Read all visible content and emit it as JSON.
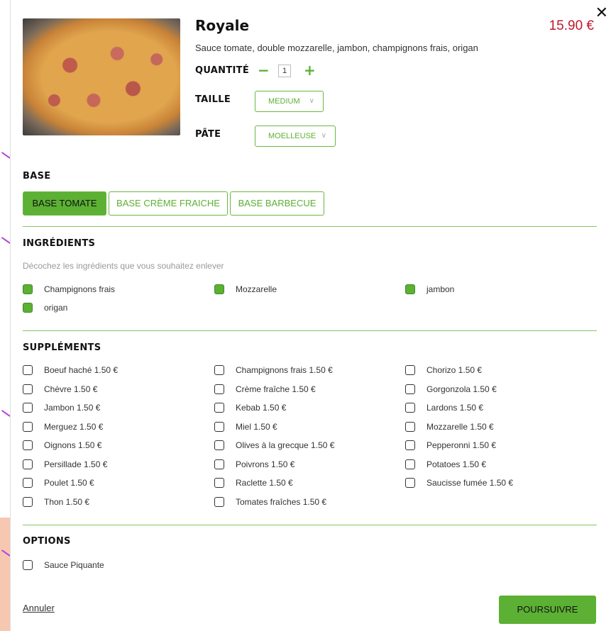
{
  "product": {
    "title": "Royale",
    "price": "15.90 €",
    "description": "Sauce tomate, double mozzarelle, jambon, champignons frais, origan",
    "close_icon": "✕"
  },
  "quantity": {
    "label": "QUANTITÉ",
    "minus": "−",
    "value": "1",
    "plus": "+"
  },
  "size": {
    "label": "TAILLE",
    "value": "MEDIUM",
    "chevron": "∨"
  },
  "dough": {
    "label": "PÂTE",
    "value": "MOELLEUSE",
    "chevron": "∨"
  },
  "base": {
    "title": "BASE",
    "options": [
      {
        "label": "BASE TOMATE",
        "active": true
      },
      {
        "label": "BASE CRÈME FRAICHE",
        "active": false
      },
      {
        "label": "BASE BARBECUE",
        "active": false
      }
    ]
  },
  "ingredients": {
    "title": "INGRÉDIENTS",
    "hint": "Décochez les ingrédients que vous souhaitez enlever",
    "items": [
      {
        "label": "Champignons frais",
        "checked": true
      },
      {
        "label": "Mozzarelle",
        "checked": true
      },
      {
        "label": "jambon",
        "checked": true
      },
      {
        "label": "origan",
        "checked": true
      }
    ]
  },
  "supplements": {
    "title": "SUPPLÉMENTS",
    "col1": [
      "Boeuf haché 1.50 €",
      "Chèvre 1.50 €",
      "Jambon 1.50 €",
      "Merguez 1.50 €",
      "Oignons 1.50 €",
      "Persillade 1.50 €",
      "Poulet 1.50 €",
      "Thon 1.50 €"
    ],
    "col2": [
      "Champignons frais 1.50 €",
      "Crème fraîche 1.50 €",
      "Kebab 1.50 €",
      "Miel 1.50 €",
      "Olives à la grecque 1.50 €",
      "Poivrons 1.50 €",
      "Raclette 1.50 €",
      "Tomates fraîches 1.50 €"
    ],
    "col3": [
      "Chorizo 1.50 €",
      "Gorgonzola 1.50 €",
      "Lardons 1.50 €",
      "Mozzarelle 1.50 €",
      "Pepperonni 1.50 €",
      "Potatoes 1.50 €",
      "Saucisse fumée 1.50 €"
    ]
  },
  "options": {
    "title": "OPTIONS",
    "items": [
      {
        "label": "Sauce Piquante",
        "checked": false
      }
    ]
  },
  "footer": {
    "cancel": "Annuler",
    "submit": "POURSUIVRE"
  },
  "colors": {
    "accent": "#5cb034",
    "price": "#c0172d"
  }
}
